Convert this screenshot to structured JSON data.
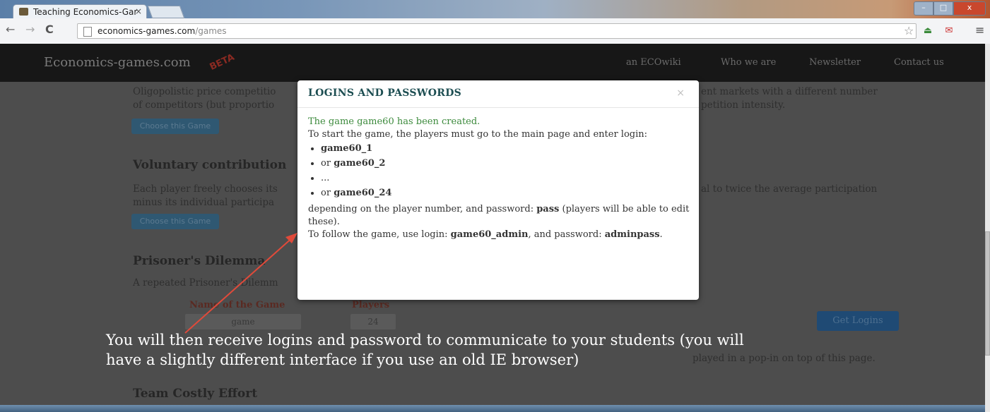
{
  "browser": {
    "tab_title": "Teaching Economics-Gar",
    "tab_close": "×",
    "url_domain": "economics-games.com",
    "url_path": "/games",
    "win_min": "–",
    "win_max": "□",
    "win_close": "x"
  },
  "site": {
    "brand": "Economics-games.com",
    "beta": "BETA",
    "nav": [
      "an ECOwiki",
      "Who we are",
      "Newsletter",
      "Contact us"
    ]
  },
  "background": {
    "oligo_line1": "Oligopolistic price competitio",
    "oligo_line1_right": "ent markets with a different number",
    "oligo_line2": "of competitors (but proportio",
    "oligo_line2_right": "petition intensity.",
    "choose_label": "Choose this Game",
    "voluntary_title": "Voluntary contribution",
    "voluntary_line1": "Each player freely chooses its",
    "voluntary_line1_right": "al to twice the average participation",
    "voluntary_line2": "minus its individual participa",
    "prisoner_title": "Prisoner's Dilemma",
    "prisoner_line": "A repeated Prisoner's Dilemm",
    "name_label": "Name of the Game",
    "players_label": "Players",
    "name_value": "game",
    "players_value": "24",
    "get_logins": "Get Logins",
    "popin_text": "played in a pop-in on top of this page.",
    "team_title": "Team Costly Effort"
  },
  "modal": {
    "title": "LOGINS AND PASSWORDS",
    "close": "×",
    "created": "The game game60 has been created.",
    "intro": "To start the game, the players must go to the main page and enter login:",
    "logins": [
      {
        "prefix": "",
        "value": "game60_1"
      },
      {
        "prefix": "or ",
        "value": "game60_2"
      },
      {
        "prefix": "...",
        "value": ""
      },
      {
        "prefix": "or ",
        "value": "game60_24"
      }
    ],
    "depending_pre": "depending on the player number, and password: ",
    "password": "pass",
    "depending_post": " (players will be able to edit these).",
    "follow_pre": "To follow the game, use login: ",
    "admin_login": "game60_admin",
    "follow_mid": ", and password: ",
    "admin_password": "adminpass",
    "follow_end": "."
  },
  "annotation": {
    "line1": "You will then receive logins and password to communicate to your students (you will",
    "line2": "have a slightly different interface if you use an old IE browser)"
  },
  "colors": {
    "success": "#3c8a3c",
    "modal_title": "#1d4e52",
    "arrow": "#e04a3a",
    "overlay": "#4d4d4d"
  }
}
